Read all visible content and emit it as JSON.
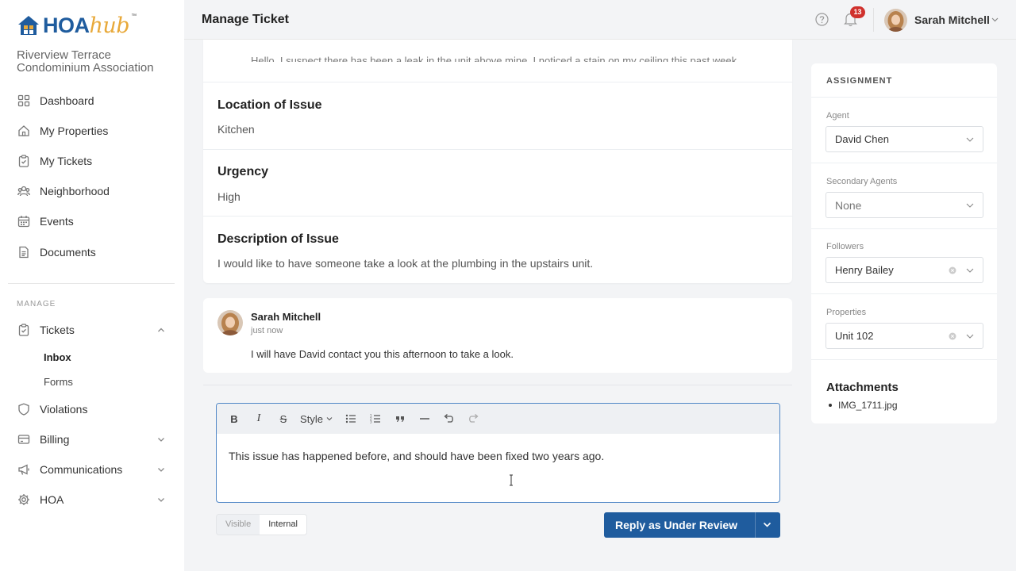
{
  "brand": {
    "name_part1": "HOA",
    "name_part2": "hub",
    "tm": "™",
    "association": "Riverview Terrace Condominium Association"
  },
  "nav": {
    "items": [
      {
        "label": "Dashboard",
        "icon": "dashboard-icon"
      },
      {
        "label": "My Properties",
        "icon": "home-icon"
      },
      {
        "label": "My Tickets",
        "icon": "clipboard-icon"
      },
      {
        "label": "Neighborhood",
        "icon": "people-icon"
      },
      {
        "label": "Events",
        "icon": "calendar-icon"
      },
      {
        "label": "Documents",
        "icon": "document-icon"
      }
    ],
    "manage_label": "MANAGE",
    "manage_items": [
      {
        "label": "Tickets",
        "icon": "clipboard-icon",
        "expanded": true
      },
      {
        "label": "Violations",
        "icon": "shield-icon"
      },
      {
        "label": "Billing",
        "icon": "billing-icon"
      },
      {
        "label": "Communications",
        "icon": "megaphone-icon"
      },
      {
        "label": "HOA",
        "icon": "gear-icon"
      }
    ],
    "ticket_sub": [
      {
        "label": "Inbox",
        "active": true
      },
      {
        "label": "Forms"
      }
    ]
  },
  "header": {
    "title": "Manage Ticket",
    "notification_count": "13",
    "user_name": "Sarah Mitchell"
  },
  "ticket": {
    "cut_text": "Hello, I suspect there has been a leak in the unit above mine. I noticed a stain on my ceiling this past week.",
    "fields": [
      {
        "label": "Location of Issue",
        "value": "Kitchen"
      },
      {
        "label": "Urgency",
        "value": "High"
      },
      {
        "label": "Description of Issue",
        "value": "I would like to have someone take a look at the plumbing in the upstairs unit."
      }
    ]
  },
  "comment": {
    "author": "Sarah Mitchell",
    "time": "just now",
    "text": "I will have David contact you this afternoon to take a look."
  },
  "editor": {
    "toolbar": {
      "bold": "B",
      "italic": "I",
      "strike": "S",
      "style": "Style"
    },
    "text": "This issue has happened before, and should have been fixed two years ago."
  },
  "visibility": {
    "visible": "Visible",
    "internal": "Internal",
    "selected": "Internal"
  },
  "reply_button": "Reply as Under Review",
  "assignment": {
    "title": "ASSIGNMENT",
    "agent_label": "Agent",
    "agent_value": "David Chen",
    "secondary_label": "Secondary Agents",
    "secondary_value": "None",
    "followers_label": "Followers",
    "followers_value": "Henry Bailey",
    "properties_label": "Properties",
    "properties_value": "Unit 102",
    "attachments_title": "Attachments",
    "attachments": [
      "IMG_1711.jpg"
    ]
  },
  "colors": {
    "brand_blue": "#1f5c9e",
    "brand_gold": "#e8a93a",
    "badge_red": "#d0312d",
    "editor_border": "#4f86c6"
  }
}
